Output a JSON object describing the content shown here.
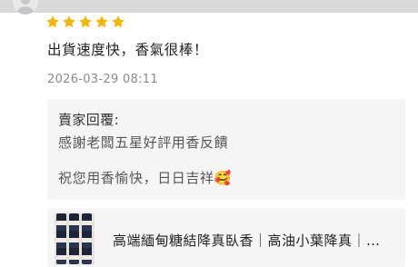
{
  "review": {
    "rating": 5,
    "max_rating": 5,
    "star_color": "#F5B400",
    "text": "出貨速度快，香氣很棒！",
    "timestamp": "2026-03-29 08:11"
  },
  "seller_reply": {
    "title": "賣家回覆:",
    "line1": "感謝老闆五星好評用香反饋",
    "line2": "祝您用香愉快，日日吉祥🥰"
  },
  "product": {
    "title": "高端緬甸糖結降真臥香｜高油小葉降真｜…",
    "thumb_icon": "incense-sticks-image"
  },
  "avatar_icon": "user-avatar-icon",
  "colors": {
    "background": "#FFFFFF",
    "panel": "#F5F5F5",
    "muted_text": "#8A8A8A"
  }
}
